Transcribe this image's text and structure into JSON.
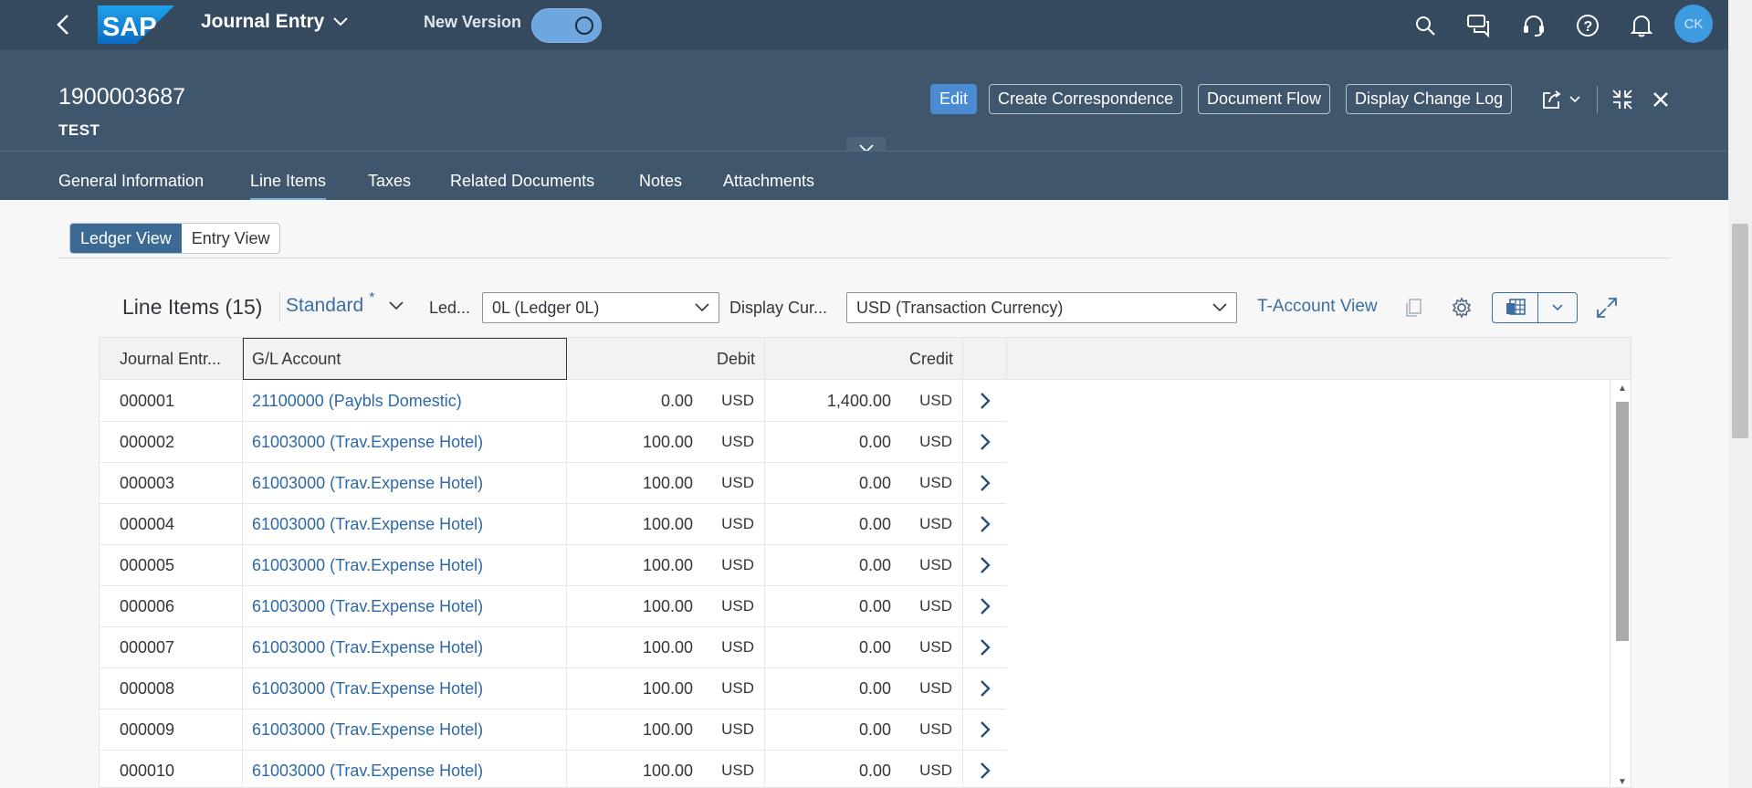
{
  "shell": {
    "app_title": "Journal Entry",
    "new_version_label": "New Version",
    "new_version_on": true,
    "avatar_initials": "CK",
    "logo_text": "SAP"
  },
  "header": {
    "title": "1900003687",
    "subtitle": "TEST",
    "buttons": {
      "edit": "Edit",
      "create_correspondence": "Create Correspondence",
      "document_flow": "Document Flow",
      "display_change_log": "Display Change Log"
    }
  },
  "tabs": [
    {
      "label": "General Information"
    },
    {
      "label": "Line Items",
      "active": true
    },
    {
      "label": "Taxes"
    },
    {
      "label": "Related Documents"
    },
    {
      "label": "Notes"
    },
    {
      "label": "Attachments"
    }
  ],
  "view_toggle": {
    "ledger": "Ledger View",
    "entry": "Entry View",
    "selected": "Ledger View"
  },
  "toolbar": {
    "title": "Line Items (15)",
    "variant": "Standard",
    "variant_modified": "*",
    "ledger_label": "Led...",
    "ledger_value": "0L (Ledger 0L)",
    "display_currency_label": "Display Cur...",
    "display_currency_value": "USD (Transaction Currency)",
    "t_account_view": "T-Account View"
  },
  "table": {
    "columns": {
      "journal_entry": "Journal Entr...",
      "gl_account": "G/L Account",
      "debit": "Debit",
      "credit": "Credit"
    },
    "rows": [
      {
        "item": "000001",
        "account": "21100000 (Paybls Domestic)",
        "debit": "0.00",
        "debit_cur": "USD",
        "credit": "1,400.00",
        "credit_cur": "USD"
      },
      {
        "item": "000002",
        "account": "61003000 (Trav.Expense Hotel)",
        "debit": "100.00",
        "debit_cur": "USD",
        "credit": "0.00",
        "credit_cur": "USD"
      },
      {
        "item": "000003",
        "account": "61003000 (Trav.Expense Hotel)",
        "debit": "100.00",
        "debit_cur": "USD",
        "credit": "0.00",
        "credit_cur": "USD"
      },
      {
        "item": "000004",
        "account": "61003000 (Trav.Expense Hotel)",
        "debit": "100.00",
        "debit_cur": "USD",
        "credit": "0.00",
        "credit_cur": "USD"
      },
      {
        "item": "000005",
        "account": "61003000 (Trav.Expense Hotel)",
        "debit": "100.00",
        "debit_cur": "USD",
        "credit": "0.00",
        "credit_cur": "USD"
      },
      {
        "item": "000006",
        "account": "61003000 (Trav.Expense Hotel)",
        "debit": "100.00",
        "debit_cur": "USD",
        "credit": "0.00",
        "credit_cur": "USD"
      },
      {
        "item": "000007",
        "account": "61003000 (Trav.Expense Hotel)",
        "debit": "100.00",
        "debit_cur": "USD",
        "credit": "0.00",
        "credit_cur": "USD"
      },
      {
        "item": "000008",
        "account": "61003000 (Trav.Expense Hotel)",
        "debit": "100.00",
        "debit_cur": "USD",
        "credit": "0.00",
        "credit_cur": "USD"
      },
      {
        "item": "000009",
        "account": "61003000 (Trav.Expense Hotel)",
        "debit": "100.00",
        "debit_cur": "USD",
        "credit": "0.00",
        "credit_cur": "USD"
      },
      {
        "item": "000010",
        "account": "61003000 (Trav.Expense Hotel)",
        "debit": "100.00",
        "debit_cur": "USD",
        "credit": "0.00",
        "credit_cur": "USD"
      }
    ]
  },
  "icons": [
    "back-icon",
    "search-icon",
    "feedback-icon",
    "help-support-icon",
    "help-icon",
    "notifications-icon",
    "share-icon",
    "exit-fullscreen-icon",
    "close-icon",
    "copy-icon",
    "settings-icon",
    "export-icon",
    "fullscreen-icon",
    "navigation-arrow-icon"
  ]
}
